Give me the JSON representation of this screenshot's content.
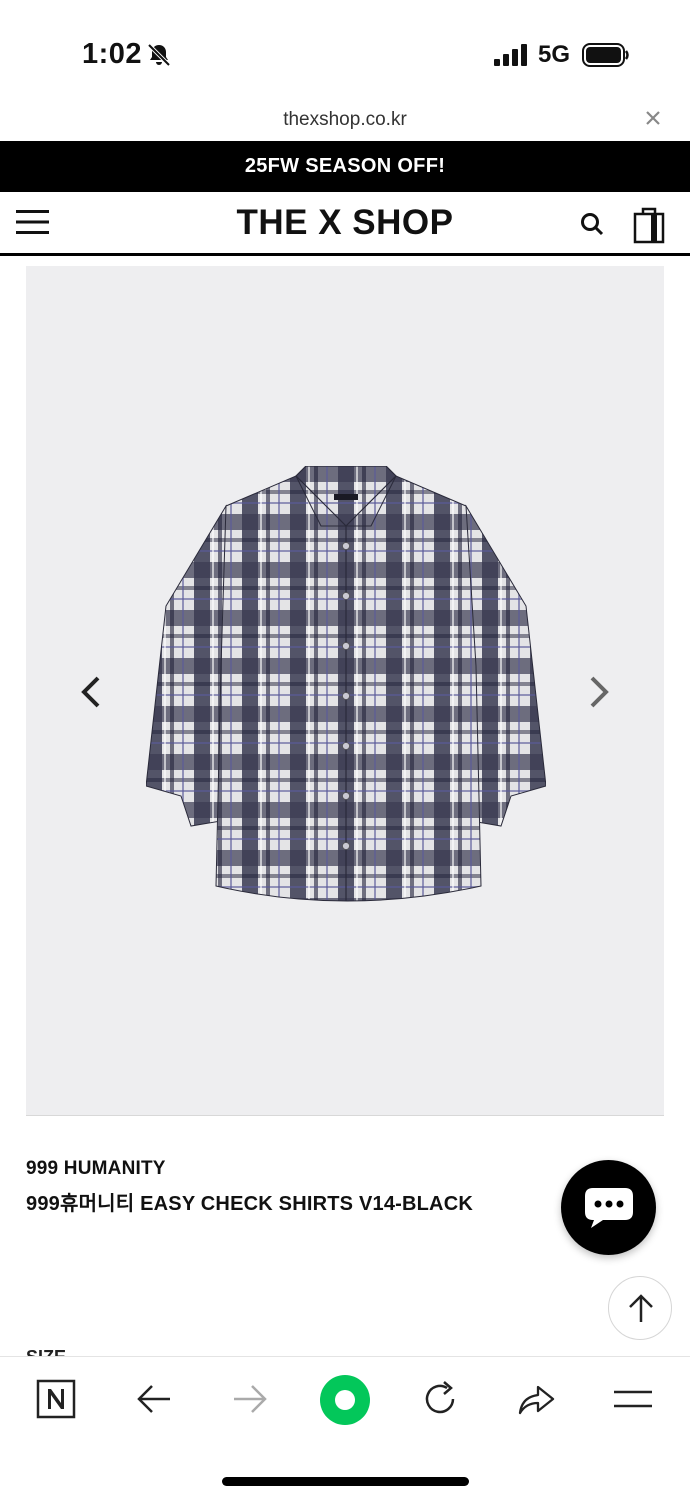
{
  "status_bar": {
    "time": "1:02",
    "network": "5G"
  },
  "url_bar": {
    "url": "thexshop.co.kr"
  },
  "banner": {
    "text": "25FW SEASON OFF!"
  },
  "header": {
    "logo": "THE X SHOP"
  },
  "product": {
    "brand": "999 HUMANITY",
    "name": "999휴머니티 EASY CHECK SHIRTS V14-BLACK",
    "size_label_partial": "SIZE"
  },
  "icons": {
    "status": [
      "bell-slash-icon",
      "signal-icon",
      "battery-icon"
    ],
    "header": [
      "menu-icon",
      "search-icon",
      "shopping-bag-icon"
    ],
    "gallery": [
      "chevron-left-icon",
      "chevron-right-icon"
    ],
    "floating": [
      "chat-icon",
      "arrow-up-icon"
    ],
    "toolbar": [
      "naver-n-icon",
      "back-arrow-icon",
      "forward-arrow-icon",
      "green-dot-icon",
      "reload-icon",
      "share-icon",
      "menu-lines-icon"
    ]
  },
  "colors": {
    "banner_bg": "#000000",
    "gallery_bg": "#eeeef0",
    "accent_green": "#03c75a"
  }
}
